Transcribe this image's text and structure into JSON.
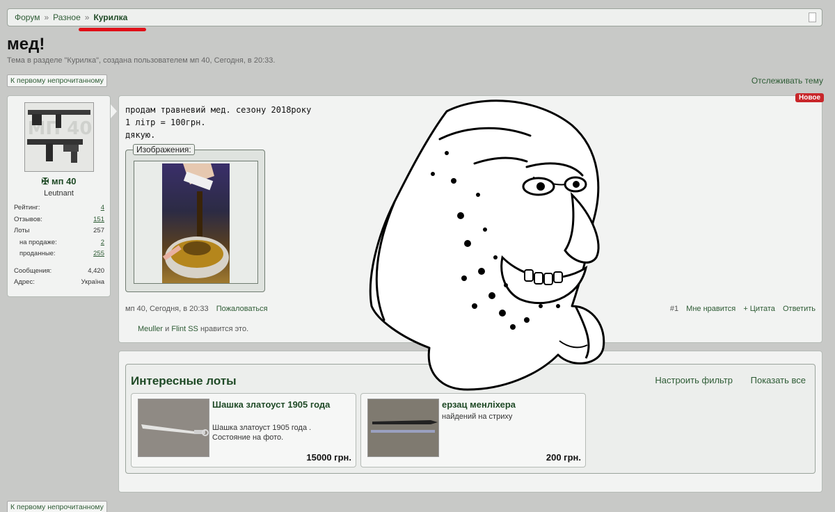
{
  "breadcrumb": {
    "items": [
      "Форум",
      "Разное"
    ],
    "separator": "»",
    "current": "Курилка"
  },
  "thread": {
    "title": "мед!",
    "subtitle": "Тема в разделе \"Курилка\", создана пользователем мп 40, Сегодня, в 20:33.",
    "first_unread": "К первому непрочитанному",
    "watch": "Отслеживать тему"
  },
  "user": {
    "name": "мп 40",
    "rank": "Leutnant",
    "stats": [
      {
        "label": "Рейтинг:",
        "value": "4",
        "link": true,
        "indent": false
      },
      {
        "label": "Отзывов:",
        "value": "151",
        "link": true,
        "indent": false
      },
      {
        "label": "Лоты",
        "value": "257",
        "link": false,
        "indent": false
      },
      {
        "label": "на продаже:",
        "value": "2",
        "link": true,
        "indent": true
      },
      {
        "label": "проданные:",
        "value": "255",
        "link": true,
        "indent": true
      }
    ],
    "messages_label": "Сообщения:",
    "messages_value": "4,420",
    "address_label": "Адрес:",
    "address_value": "Україна",
    "avatar_text": "МП 40"
  },
  "post": {
    "lines": [
      "продам травневий мед. сезону 2018року",
      "1 літр = 100грн.",
      "дякую."
    ],
    "new_badge": "Новое",
    "images_legend": "Изображения:",
    "author": "мп 40",
    "date": "Сегодня, в 20:33",
    "report": "Пожаловаться",
    "number": "#1",
    "like": "Мне нравится",
    "quote": "+ Цитата",
    "reply": "Ответить",
    "likes_user1": "Meuller",
    "likes_and": "и",
    "likes_user2": "Flint SS",
    "likes_suffix": "нравится это."
  },
  "lots": {
    "title": "Интересные лоты",
    "filter": "Настроить фильтр",
    "show_all": "Показать все",
    "items": [
      {
        "title": "Шашка златоуст 1905 года",
        "desc": "Шашка златоуст 1905 года . Состояние на фото.",
        "price": "15000 грн."
      },
      {
        "title": "ерзац менліхера",
        "desc": "найдений на стриху",
        "price": "200 грн."
      }
    ]
  },
  "colors": {
    "accent": "#2d5b34",
    "badge": "#c8262a",
    "highlight": "#e01018"
  }
}
